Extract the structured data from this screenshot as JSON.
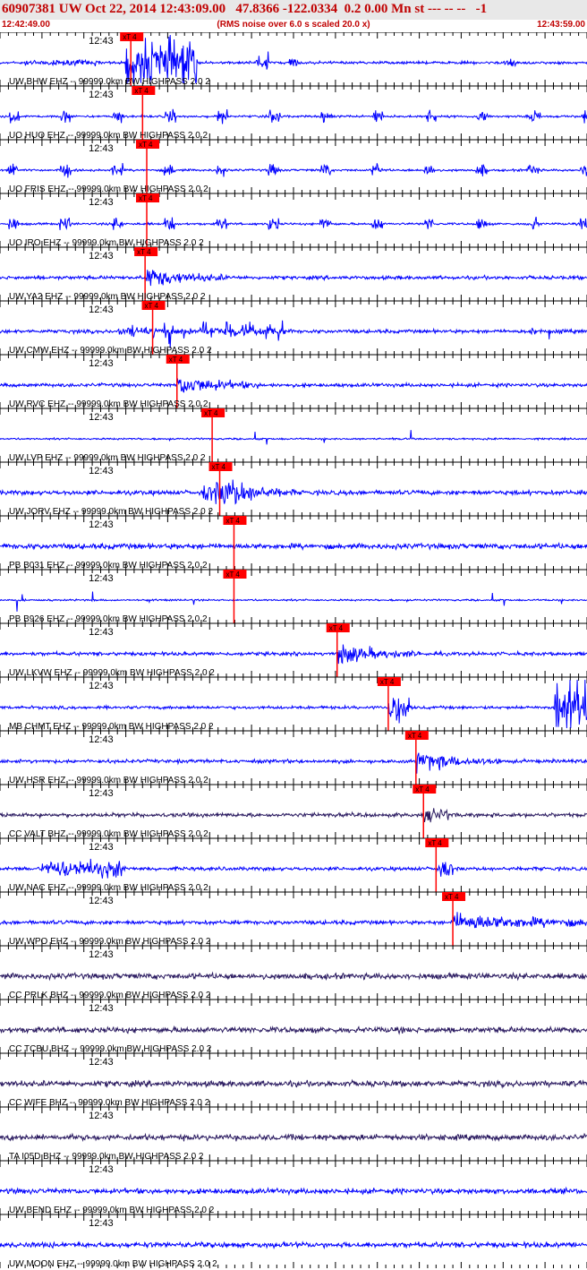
{
  "header": {
    "title": "60907381 UW Oct 22, 2014 12:43:09.00   47.8366 -122.0334  0.2 0.00 Mn st --- -- --   -1",
    "start_time": "12:42:49.00",
    "rms_note": "(RMS noise over 6.0 s scaled 20.0 x)",
    "end_time": "12:43:59.00"
  },
  "colors": {
    "trace": "#0000ff",
    "trace_dark": "#2a1a60",
    "pick_line": "#ff0000",
    "pick_flag": "#ff0000",
    "header_text": "#c00000",
    "header_bg": "#e8e8e8"
  },
  "chart_data": {
    "type": "line",
    "x_axis": {
      "unit": "seconds",
      "start_time": "12:42:49.00",
      "end_time": "12:43:59.00",
      "range": [
        0,
        70
      ],
      "minute_tick_label": "12:43",
      "minute_tick_at": 11
    },
    "pick_label": "xT 4",
    "channels": [
      {
        "label": "UW BHW EHZ -- 99999.0km BW  HIGHPASS  2.0  2",
        "pick": 15.6,
        "style": "swarm_early",
        "dark": false
      },
      {
        "label": "UO HUO EHZ -- 99999.0km BW  HIGHPASS  2.0  2",
        "pick": 17.0,
        "style": "bursts",
        "dark": false
      },
      {
        "label": "UO FRIS EHZ -- 99999.0km BW  HIGHPASS  2.0  2",
        "pick": 17.5,
        "style": "bursts",
        "dark": false
      },
      {
        "label": "UO IRO EHZ -- 99999.0km BW  HIGHPASS  2.0  2",
        "pick": 17.5,
        "style": "bursts",
        "dark": false
      },
      {
        "label": "UW YA2 EHZ -- 99999.0km BW  HIGHPASS  2.0  2",
        "pick": 17.3,
        "style": "event",
        "dark": false
      },
      {
        "label": "UW CMW EHZ -- 99999.0km BW  HIGHPASS  2.0  2",
        "pick": 18.2,
        "style": "spiky",
        "dark": false
      },
      {
        "label": "UW RVC EHZ -- 99999.0km BW  HIGHPASS  2.0  2",
        "pick": 21.1,
        "style": "event",
        "dark": false
      },
      {
        "label": "UW LVP EHZ -- 99999.0km BW  HIGHPASS  2.0  2",
        "pick": 25.3,
        "style": "quiet",
        "dark": false
      },
      {
        "label": "UW JORV EHZ -- 99999.0km BW  HIGHPASS  2.0  2",
        "pick": 26.2,
        "style": "event_big",
        "dark": false
      },
      {
        "label": "PB B031 EHZ -- 99999.0km BW  HIGHPASS  2.0  2",
        "pick": 27.9,
        "style": "noisy",
        "dark": false
      },
      {
        "label": "PB B926 EHZ -- 99999.0km BW  HIGHPASS  2.0  2",
        "pick": 27.9,
        "style": "quiet",
        "dark": false
      },
      {
        "label": "UW LKVW EHZ -- 99999.0km BW  HIGHPASS  2.0  2",
        "pick": 40.2,
        "style": "event",
        "dark": false
      },
      {
        "label": "MB CHMT EHZ -- 99999.0km BW  HIGHPASS  2.0  2",
        "pick": 46.3,
        "style": "late_spike",
        "dark": false
      },
      {
        "label": "UW HSR EHZ -- 99999.0km BW  HIGHPASS  2.0  2",
        "pick": 49.6,
        "style": "event",
        "dark": false
      },
      {
        "label": "CC VALT BHZ -- 99999.0km BW  HIGHPASS  2.0  2",
        "pick": 50.5,
        "style": "dark_event",
        "dark": true
      },
      {
        "label": "UW NAC EHZ -- 99999.0km BW  HIGHPASS  2.0  2",
        "pick": 52.0,
        "style": "early_noise",
        "dark": false
      },
      {
        "label": "UW WPO EHZ -- 99999.0km BW  HIGHPASS  2.0  2",
        "pick": 54.0,
        "style": "late_event",
        "dark": false
      },
      {
        "label": "CC PRLK BHZ -- 99999.0km BW  HIGHPASS  2.0  2",
        "pick": null,
        "style": "dark_noise",
        "dark": true
      },
      {
        "label": "CC TCBU BHZ -- 99999.0km BW  HIGHPASS  2.0  2",
        "pick": null,
        "style": "dark_noise",
        "dark": true
      },
      {
        "label": "CC WIFE BHZ -- 99999.0km BW  HIGHPASS  2.0  2",
        "pick": null,
        "style": "dark_noise",
        "dark": true
      },
      {
        "label": "TA I05D BHZ -- 99999.0km BW  HIGHPASS  2.0  2",
        "pick": null,
        "style": "dark_noise",
        "dark": true
      },
      {
        "label": "UW BEND EHZ -- 99999.0km BW  HIGHPASS  2.0  2",
        "pick": null,
        "style": "noisy",
        "dark": false
      },
      {
        "label": "UW MOON EHZ -- 99999.0km BW  HIGHPASS  2.0  2",
        "pick": null,
        "style": "noisy",
        "dark": false
      }
    ]
  }
}
